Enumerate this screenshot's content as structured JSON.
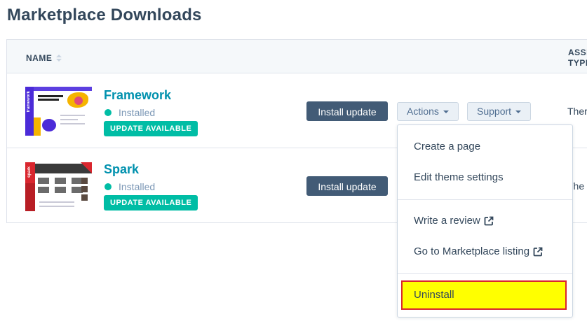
{
  "page": {
    "title": "Marketplace Downloads"
  },
  "table": {
    "headers": {
      "name": "NAME",
      "asset_type_line1": "ASSE",
      "asset_type_line2": "TYPE"
    },
    "rows": [
      {
        "name": "Framework",
        "status": "Installed",
        "badge": "UPDATE AVAILABLE",
        "install_label": "Install update",
        "actions_label": "Actions",
        "support_label": "Support",
        "asset_type": "Ther",
        "thumb_text": "framework"
      },
      {
        "name": "Spark",
        "status": "Installed",
        "badge": "UPDATE AVAILABLE",
        "install_label": "Install update",
        "asset_type": "The",
        "thumb_text": "spark"
      }
    ]
  },
  "dropdown": {
    "items": [
      {
        "label": "Create a page"
      },
      {
        "label": "Edit theme settings"
      },
      {
        "label": "Write a review",
        "icon": "external-link-icon"
      },
      {
        "label": "Go to Marketplace listing",
        "icon": "external-link-icon"
      },
      {
        "label": "Uninstall",
        "highlighted": true
      }
    ]
  },
  "colors": {
    "link": "#0091ae",
    "badge": "#00bda5",
    "primary_button": "#425b76",
    "highlight": "#ffff00",
    "highlight_border": "#d9262e"
  }
}
